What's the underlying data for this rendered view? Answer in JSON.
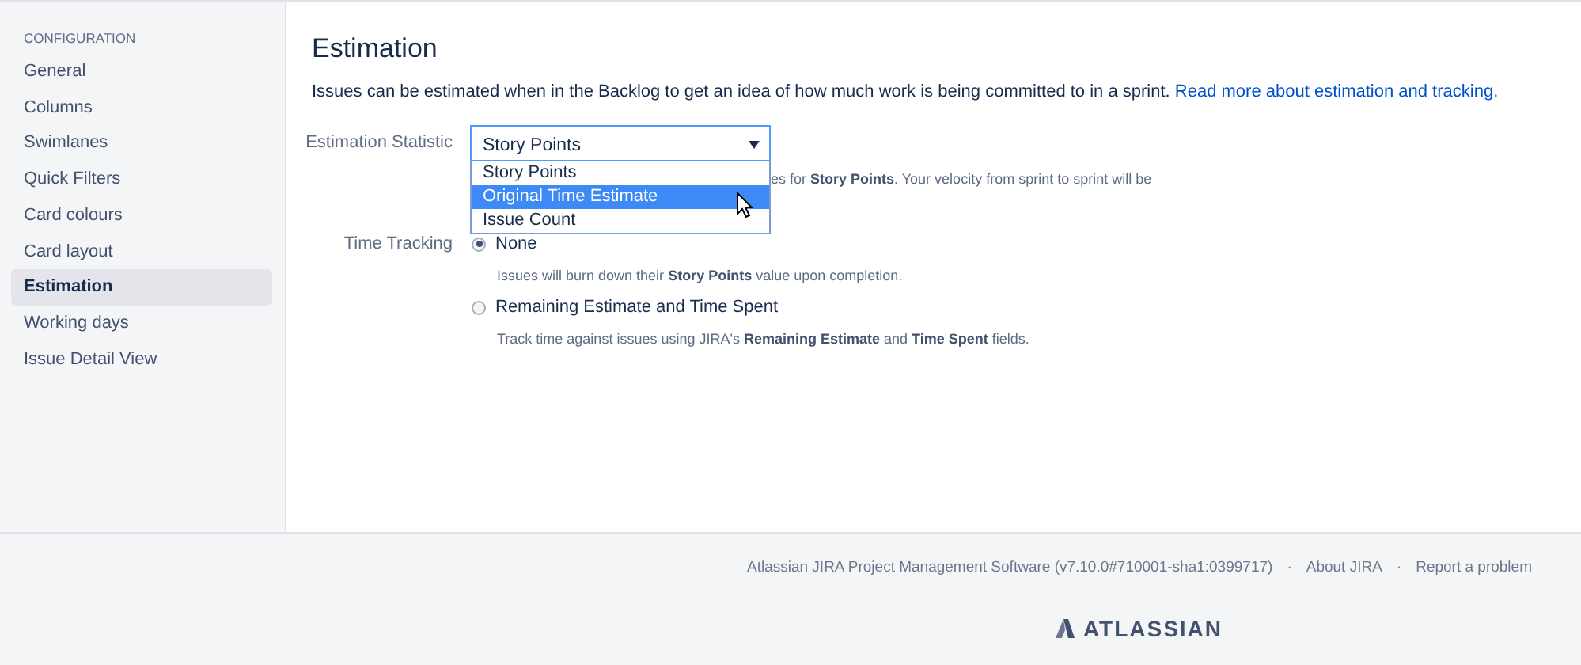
{
  "sidebar": {
    "heading": "CONFIGURATION",
    "items": [
      {
        "label": "General",
        "selected": false
      },
      {
        "label": "Columns",
        "selected": false
      },
      {
        "label": "Swimlanes",
        "selected": false
      },
      {
        "label": "Quick Filters",
        "selected": false
      },
      {
        "label": "Card colours",
        "selected": false
      },
      {
        "label": "Card layout",
        "selected": false
      },
      {
        "label": "Estimation",
        "selected": true
      },
      {
        "label": "Working days",
        "selected": false
      },
      {
        "label": "Issue Detail View",
        "selected": false
      }
    ]
  },
  "page": {
    "title": "Estimation",
    "description": "Issues can be estimated when in the Backlog to get an idea of how much work is being committed to in a sprint.",
    "link": "Read more about estimation and tracking."
  },
  "estimation_statistic": {
    "label": "Estimation Statistic",
    "value": "Story Points",
    "expanded": true,
    "hint": "es for **Story Points**. Your velocity from sprint to sprint will be",
    "options": [
      {
        "label": "Story Points",
        "highlighted": false
      },
      {
        "label": "Original Time Estimate",
        "highlighted": true
      },
      {
        "label": "Issue Count",
        "highlighted": false
      }
    ]
  },
  "time_tracking": {
    "label": "Time Tracking",
    "options": [
      {
        "label": "None",
        "selected": true,
        "hint": "Issues will burn down their **Story Points** value upon completion."
      },
      {
        "label": "Remaining Estimate and Time Spent",
        "selected": false,
        "hint": "Track time against issues using JIRA's **Remaining Estimate** and **Time Spent** fields."
      }
    ]
  },
  "footer": {
    "text": "Atlassian JIRA Project Management Software (v7.10.0#710001-sha1:0399717)",
    "separator": "·",
    "links": [
      "About JIRA",
      "Report a problem"
    ],
    "logo": "ATLASSIAN"
  }
}
